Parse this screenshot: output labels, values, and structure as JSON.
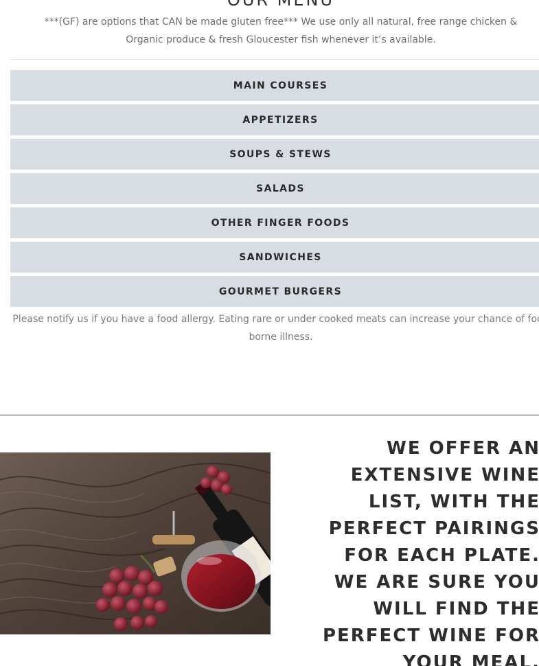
{
  "menu": {
    "title": "OUR MENU",
    "intro": "***(GF) are options that CAN be made gluten free*** We use only all natural, free range chicken & Organic produce & fresh Gloucester fish whenever it’s available.",
    "categories": [
      {
        "label": "MAIN COURSES"
      },
      {
        "label": "APPETIZERS"
      },
      {
        "label": "SOUPS & STEWS"
      },
      {
        "label": "SALADS"
      },
      {
        "label": "OTHER FINGER FOODS"
      },
      {
        "label": "SANDWICHES"
      },
      {
        "label": "GOURMET BURGERS"
      }
    ],
    "allergy_note": "Please notify us if you have a food allergy. Eating rare or under cooked meats can increase your chance of food borne illness."
  },
  "wine": {
    "heading": "WE OFFER AN EXTENSIVE WINE LIST, WITH THE PERFECT PAIRINGS FOR EACH PLATE. WE ARE SURE YOU WILL FIND THE PERFECT WINE FOR YOUR MEAL.",
    "image_icon": "wine-bottle-grapes-photo"
  },
  "colors": {
    "category_bg": "#d7dde3",
    "text_dark": "#2b2b2b",
    "text_muted": "#6e6e6e",
    "wood": "#5a4a40",
    "wine": "#7a0e1a",
    "grape": "#8a1c2c"
  }
}
